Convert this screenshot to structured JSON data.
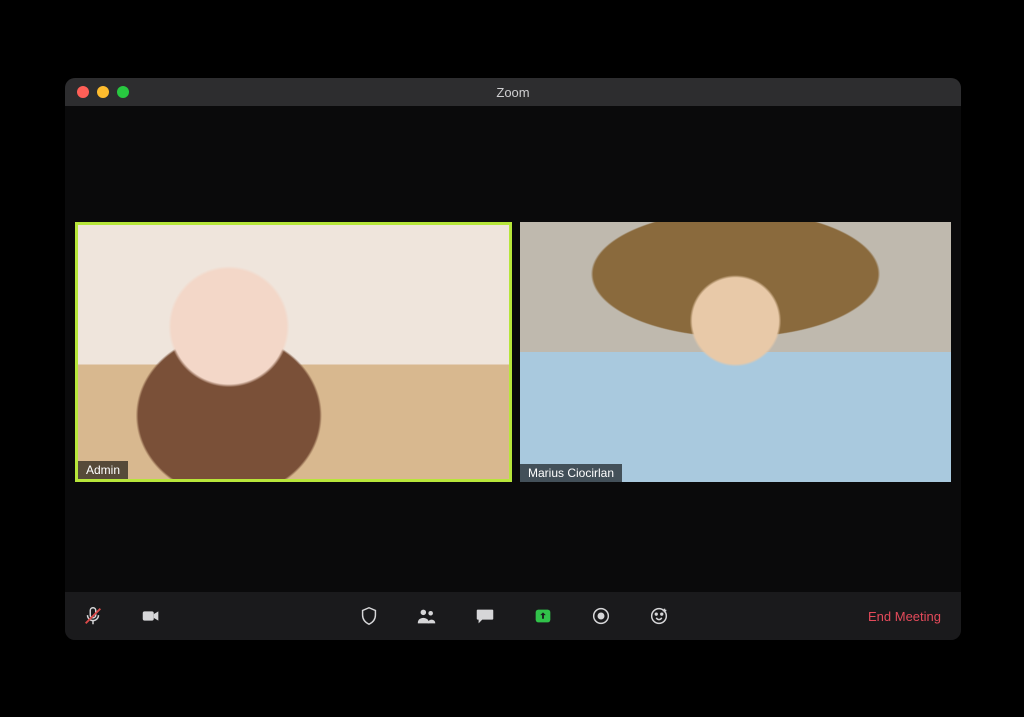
{
  "window": {
    "title": "Zoom"
  },
  "participants": [
    {
      "name": "Admin",
      "active_speaker": true
    },
    {
      "name": "Marius Ciocirlan",
      "active_speaker": false
    }
  ],
  "toolbar": {
    "mute_icon": "microphone-muted-icon",
    "video_icon": "video-icon",
    "security_icon": "shield-icon",
    "participants_icon": "participants-icon",
    "chat_icon": "chat-icon",
    "share_icon": "share-screen-icon",
    "record_icon": "record-icon",
    "reactions_icon": "reactions-icon",
    "end_label": "End Meeting"
  },
  "colors": {
    "active_speaker_border": "#b7e63a",
    "share_green": "#31c24a",
    "end_red": "#e44a5a"
  }
}
